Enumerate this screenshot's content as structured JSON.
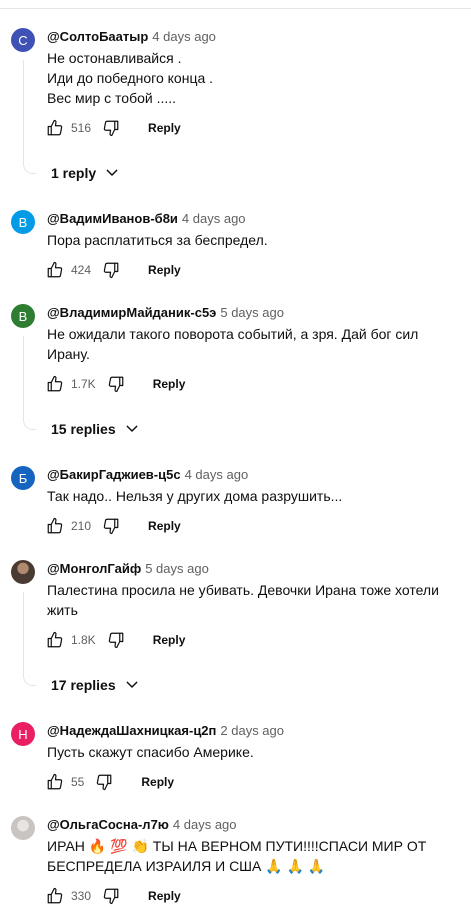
{
  "comments": [
    {
      "avatar_letter": "С",
      "avatar_color": "#3f51b5",
      "author": "@СолтоБаатыр",
      "time": "4 days ago",
      "lines": [
        "Не остонавливайся .",
        "Иди до победного конца .",
        "Вес мир с тобой ....."
      ],
      "likes": "516",
      "reply_label": "Reply",
      "replies_label": "1 reply"
    },
    {
      "avatar_letter": "В",
      "avatar_color": "#039be5",
      "author": "@ВадимИванов-б8и",
      "time": "4 days ago",
      "lines": [
        "Пора расплатиться за беспредел."
      ],
      "likes": "424",
      "reply_label": "Reply"
    },
    {
      "avatar_letter": "В",
      "avatar_color": "#2e7d32",
      "author": "@ВладимирМайданик-с5э",
      "time": "5 days ago",
      "lines": [
        "Не ожидали такого поворота событий, а зря. Дай бог сил",
        "Ирану."
      ],
      "likes": "1.7K",
      "reply_label": "Reply",
      "replies_label": "15 replies"
    },
    {
      "avatar_letter": "Б",
      "avatar_color": "#1565c0",
      "author": "@БакирГаджиев-ц5с",
      "time": "4 days ago",
      "lines": [
        "Так надо.. Нельзя у других дома разрушить..."
      ],
      "likes": "210",
      "reply_label": "Reply"
    },
    {
      "avatar_letter": "",
      "avatar_color": "#4a3b32",
      "author": "@МонголГайф",
      "time": "5 days ago",
      "lines": [
        "Палестина просила не убивать. Девочки Ирана тоже хотели",
        "жить"
      ],
      "likes": "1.8K",
      "reply_label": "Reply",
      "replies_label": "17 replies"
    },
    {
      "avatar_letter": "Н",
      "avatar_color": "#e91e63",
      "author": "@НадеждаШахницкая-ц2п",
      "time": "2 days ago",
      "lines": [
        "Пусть скажут спасибо Америке."
      ],
      "likes": "55",
      "reply_label": "Reply"
    },
    {
      "avatar_letter": "",
      "avatar_color": "#c9c4c1",
      "author": "@ОльгаСосна-л7ю",
      "time": "4 days ago",
      "lines": [
        "ИРАН 🔥 💯 👏 ТЫ НА ВЕРНОМ ПУТИ!!!!СПАСИ МИР ОТ",
        "БЕСПРЕДЕЛА ИЗРАИЛЯ И США 🙏 🙏 🙏"
      ],
      "likes": "330",
      "reply_label": "Reply"
    }
  ],
  "icons": {
    "like": "thumbs-up-icon",
    "dislike": "thumbs-down-icon",
    "expand": "chevron-down-icon"
  }
}
